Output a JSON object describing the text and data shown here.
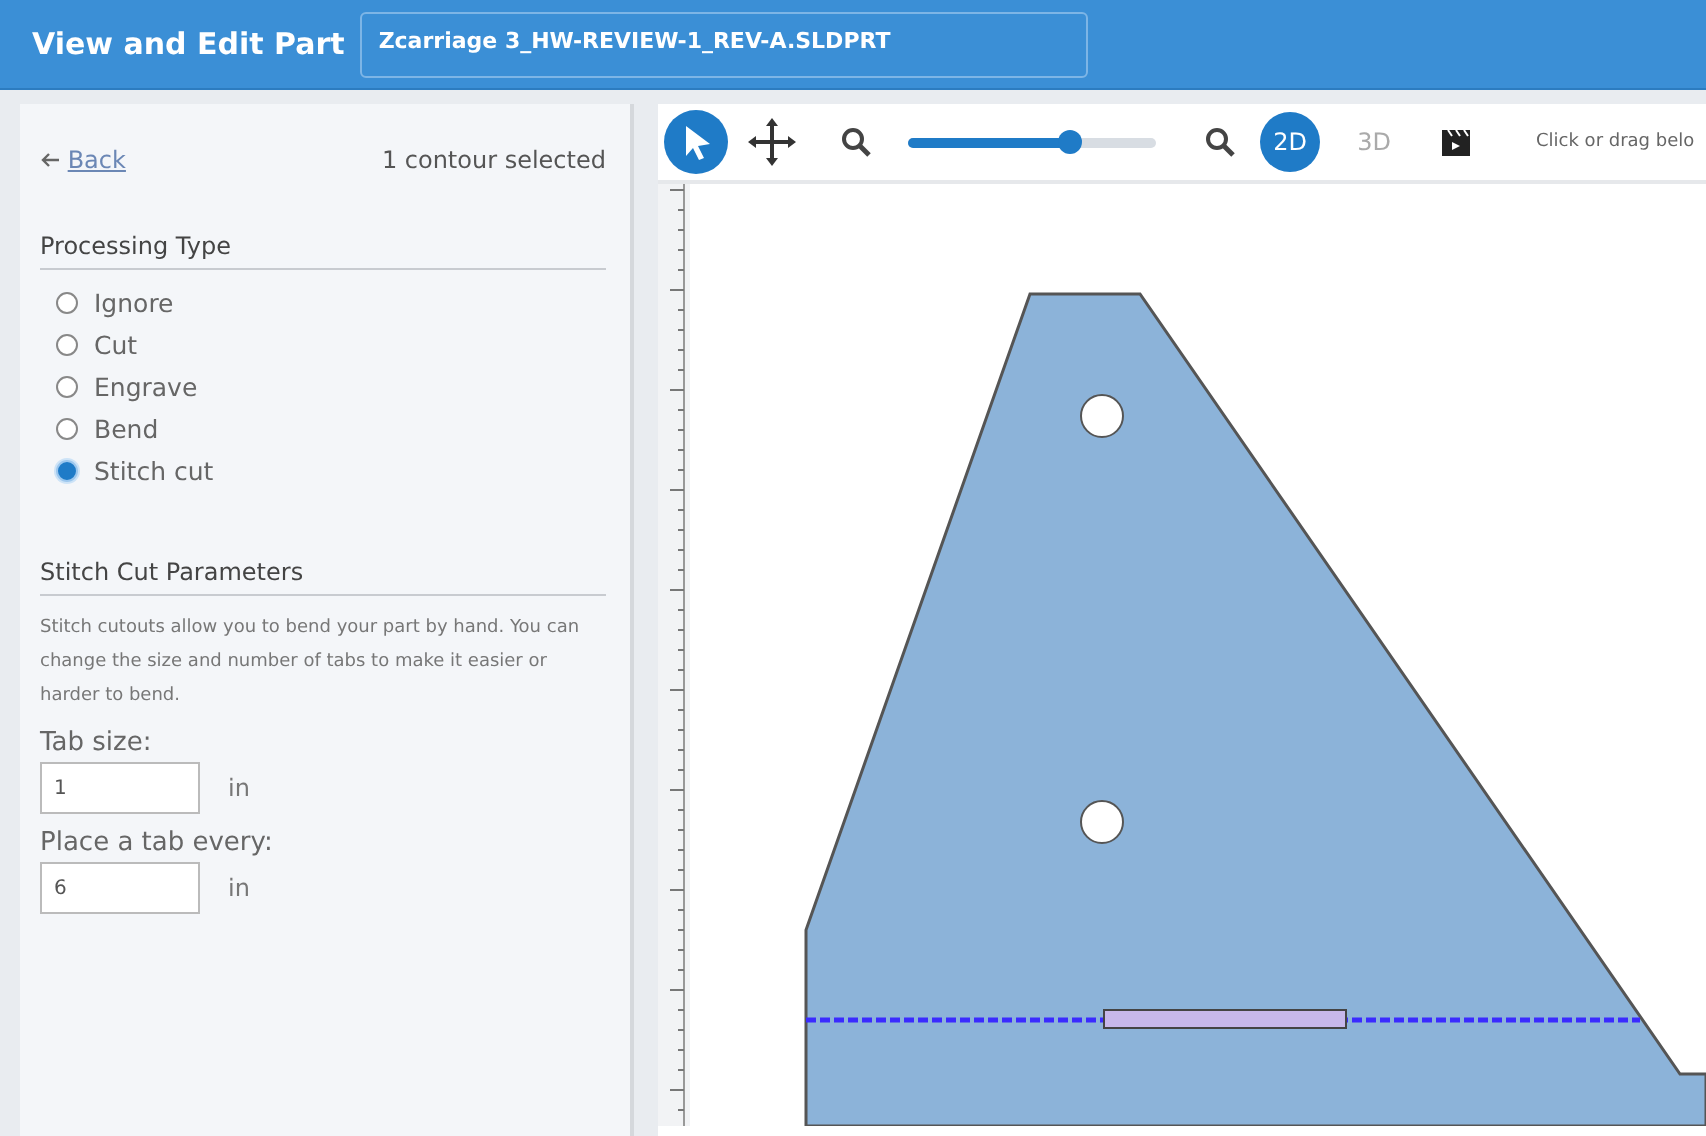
{
  "header": {
    "title": "View and Edit Part",
    "file_name": "Zcarriage 3_HW-REVIEW-1_REV-A.SLDPRT"
  },
  "panel": {
    "back_link": "Back",
    "selection_status": "1 contour selected",
    "processing_type": {
      "heading": "Processing Type",
      "options": [
        {
          "label": "Ignore",
          "selected": false
        },
        {
          "label": "Cut",
          "selected": false
        },
        {
          "label": "Engrave",
          "selected": false
        },
        {
          "label": "Bend",
          "selected": false
        },
        {
          "label": "Stitch cut",
          "selected": true
        }
      ]
    },
    "stitch_cut": {
      "heading": "Stitch Cut Parameters",
      "description": "Stitch cutouts allow you to bend your part by hand. You can change the size and number of tabs to make it easier or harder to bend.",
      "fields": [
        {
          "label": "Tab size:",
          "value": "1",
          "unit": "in"
        },
        {
          "label": "Place a tab every:",
          "value": "6",
          "unit": "in"
        }
      ]
    }
  },
  "toolbar": {
    "tools": [
      {
        "kind": "select",
        "selected": true
      },
      {
        "kind": "move",
        "selected": false
      }
    ],
    "zoom_slider": {
      "level": 0.65
    },
    "view_modes": [
      {
        "label": "2D",
        "selected": true
      },
      {
        "label": "3D",
        "selected": false
      }
    ],
    "hint": "Click or drag belo"
  }
}
